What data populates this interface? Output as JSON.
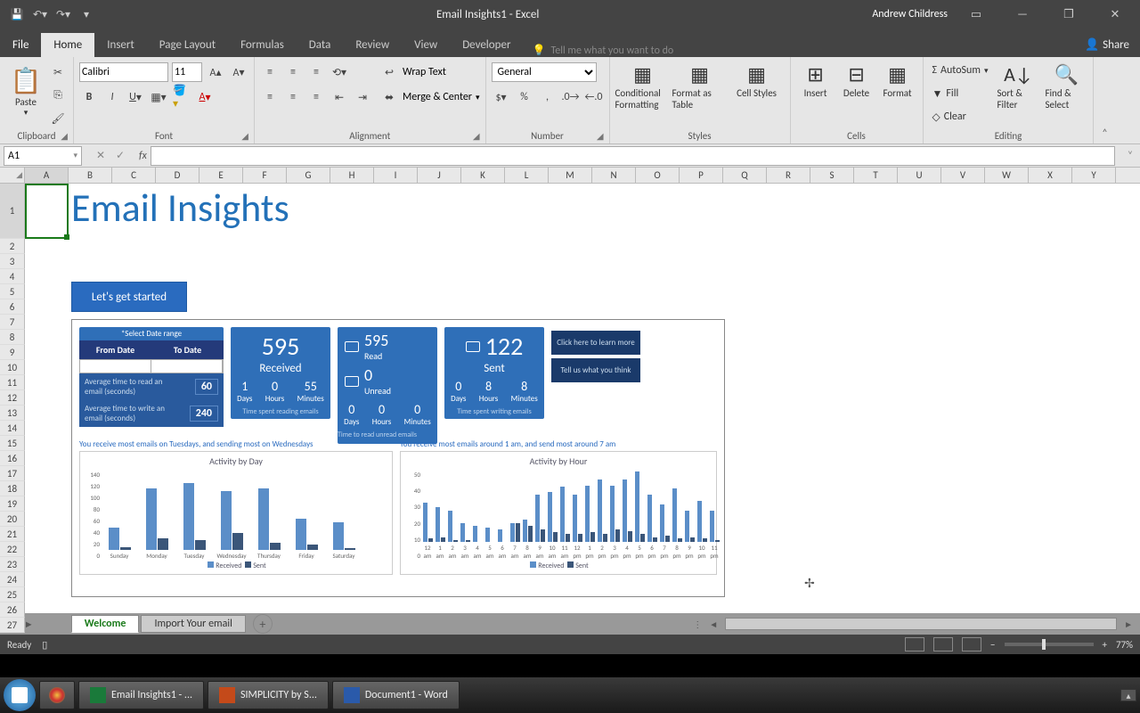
{
  "titlebar": {
    "doc_title": "Email Insights1 - Excel",
    "user": "Andrew Childress"
  },
  "ribbon": {
    "tabs": {
      "file": "File",
      "home": "Home",
      "insert": "Insert",
      "layout": "Page Layout",
      "formulas": "Formulas",
      "data": "Data",
      "review": "Review",
      "view": "View",
      "developer": "Developer"
    },
    "tell_me": "Tell me what you want to do",
    "share": "Share",
    "font_name": "Calibri",
    "font_size": "11",
    "number_format": "General",
    "wrap": "Wrap Text",
    "merge": "Merge & Center",
    "groups": {
      "clipboard": "Clipboard",
      "font": "Font",
      "alignment": "Alignment",
      "number": "Number",
      "styles": "Styles",
      "cells": "Cells",
      "editing": "Editing"
    },
    "paste": "Paste",
    "cond_fmt": "Conditional Formatting",
    "fmt_table": "Format as Table",
    "cell_styles": "Cell Styles",
    "insert_btn": "Insert",
    "delete_btn": "Delete",
    "format_btn": "Format",
    "autosum": "AutoSum",
    "fill": "Fill",
    "clear": "Clear",
    "sort": "Sort & Filter",
    "find": "Find & Select"
  },
  "name_box": "A1",
  "columns": [
    "A",
    "B",
    "C",
    "D",
    "E",
    "F",
    "G",
    "H",
    "I",
    "J",
    "K",
    "L",
    "M",
    "N",
    "O",
    "P",
    "Q",
    "R",
    "S",
    "T",
    "U",
    "V",
    "W",
    "X",
    "Y"
  ],
  "rows": [
    "1",
    "2",
    "3",
    "4",
    "5",
    "6",
    "7",
    "8",
    "9",
    "10",
    "11",
    "12",
    "13",
    "14",
    "15",
    "16",
    "17",
    "18",
    "19",
    "20",
    "21",
    "22",
    "23",
    "24",
    "25",
    "26",
    "27"
  ],
  "sheet": {
    "title": "Email Insights",
    "cta": "Let's get started",
    "date_title": "*Select Date range",
    "date_from": "From Date",
    "date_to": "To Date",
    "avg_read": "Average time to read an email (seconds)",
    "avg_read_v": "60",
    "avg_write": "Average time to write an email (seconds)",
    "avg_write_v": "240",
    "received_n": "595",
    "received_l": "Received",
    "read_n": "595",
    "read_l": "Read",
    "unread_n": "0",
    "unread_l": "Unread",
    "sent_n": "122",
    "sent_l": "Sent",
    "reading_time": {
      "days": "1",
      "hours": "0",
      "minutes": "55",
      "note": "Time spent reading emails"
    },
    "unread_time": {
      "days": "0",
      "hours": "0",
      "minutes": "0",
      "note": "Time to read unread emails"
    },
    "writing_time": {
      "days": "0",
      "hours": "8",
      "minutes": "8",
      "note": "Time spent writing emails"
    },
    "learn_more": "Click here to learn more",
    "feedback": "Tell us what you think",
    "chart1_note": "You receive most emails on Tuesdays, and sending most on Wednesdays",
    "chart2_note": "You receive most emails around 1 am, and send most around 7 am",
    "chart1_title": "Activity by Day",
    "chart2_title": "Activity by Hour",
    "legend_r": "Received",
    "legend_s": "Sent",
    "u_days": "Days",
    "u_hours": "Hours",
    "u_minutes": "Minutes"
  },
  "tabs": {
    "welcome": "Welcome",
    "import": "Import Your email"
  },
  "status": {
    "ready": "Ready",
    "zoom": "77%"
  },
  "taskbar": {
    "excel": "Email Insights1 - ...",
    "ppt": "SIMPLICITY by S...",
    "word": "Document1 - Word"
  },
  "chart_data": [
    {
      "type": "bar",
      "title": "Activity by Day",
      "categories": [
        "Sunday",
        "Monday",
        "Tuesday",
        "Wednesday",
        "Thursday",
        "Friday",
        "Saturday"
      ],
      "series": [
        {
          "name": "Received",
          "values": [
            40,
            110,
            120,
            105,
            110,
            55,
            50
          ]
        },
        {
          "name": "Sent",
          "values": [
            5,
            20,
            18,
            30,
            12,
            10,
            3
          ]
        }
      ],
      "ylim": [
        0,
        140
      ],
      "yticks": [
        0,
        20,
        40,
        60,
        80,
        100,
        120,
        140
      ],
      "xlabel": "",
      "ylabel": ""
    },
    {
      "type": "bar",
      "title": "Activity by Hour",
      "categories": [
        "12 am",
        "1 am",
        "2 am",
        "3 am",
        "4 am",
        "5 am",
        "6 am",
        "7 am",
        "8 am",
        "9 am",
        "10 am",
        "11 am",
        "12 pm",
        "1 pm",
        "2 pm",
        "3 pm",
        "4 pm",
        "5 pm",
        "6 pm",
        "7 pm",
        "8 pm",
        "9 pm",
        "10 pm",
        "11 pm"
      ],
      "series": [
        {
          "name": "Received",
          "values": [
            25,
            22,
            20,
            12,
            10,
            9,
            8,
            12,
            14,
            30,
            32,
            35,
            30,
            36,
            40,
            36,
            40,
            45,
            30,
            24,
            34,
            20,
            26,
            20
          ]
        },
        {
          "name": "Sent",
          "values": [
            2,
            3,
            1,
            1,
            0,
            0,
            0,
            12,
            10,
            8,
            6,
            5,
            5,
            6,
            5,
            8,
            7,
            5,
            3,
            4,
            2,
            3,
            2,
            1
          ]
        }
      ],
      "ylim": [
        0,
        50
      ],
      "yticks": [
        0,
        10,
        20,
        30,
        40,
        50
      ],
      "xlabel": "",
      "ylabel": ""
    }
  ]
}
